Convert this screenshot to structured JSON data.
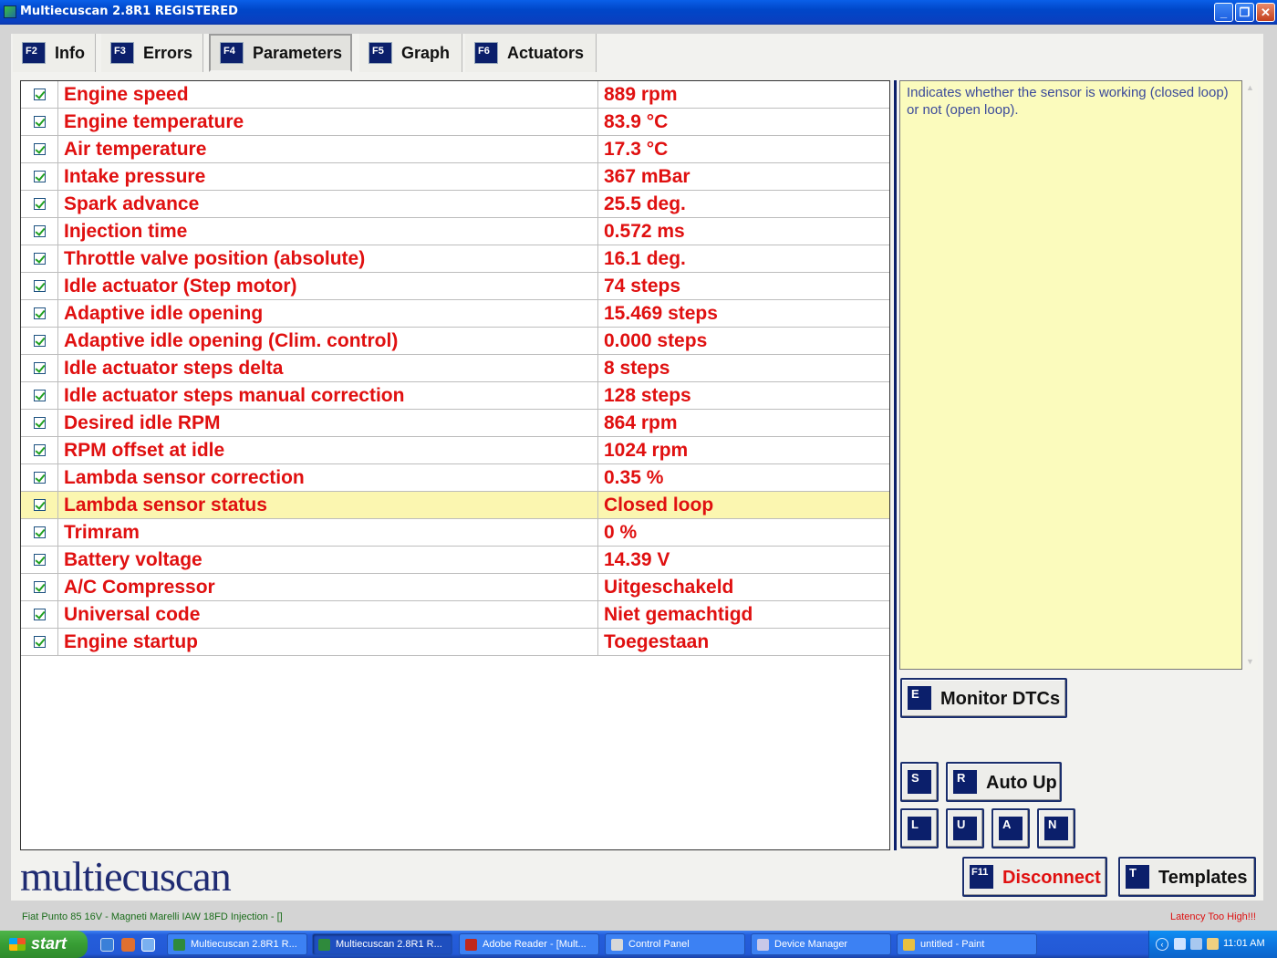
{
  "window": {
    "title": "Multiecuscan 2.8R1 REGISTERED",
    "minimize": "_",
    "maximize": "❐",
    "close": "✕"
  },
  "tabs": [
    {
      "key": "F2",
      "label": "Info"
    },
    {
      "key": "F3",
      "label": "Errors"
    },
    {
      "key": "F4",
      "label": "Parameters"
    },
    {
      "key": "F5",
      "label": "Graph"
    },
    {
      "key": "F6",
      "label": "Actuators"
    }
  ],
  "active_tab": "Parameters",
  "parameters": [
    {
      "name": "Engine speed",
      "value": "889 rpm",
      "checked": true
    },
    {
      "name": "Engine temperature",
      "value": "83.9 °C",
      "checked": true
    },
    {
      "name": "Air temperature",
      "value": "17.3 °C",
      "checked": true
    },
    {
      "name": "Intake pressure",
      "value": "367 mBar",
      "checked": true
    },
    {
      "name": "Spark advance",
      "value": "25.5 deg.",
      "checked": true
    },
    {
      "name": "Injection time",
      "value": "0.572 ms",
      "checked": true
    },
    {
      "name": "Throttle valve position (absolute)",
      "value": "16.1 deg.",
      "checked": true
    },
    {
      "name": "Idle actuator (Step motor)",
      "value": "74 steps",
      "checked": true
    },
    {
      "name": "Adaptive idle opening",
      "value": "15.469 steps",
      "checked": true
    },
    {
      "name": "Adaptive idle opening (Clim. control)",
      "value": "0.000 steps",
      "checked": true
    },
    {
      "name": "Idle actuator steps delta",
      "value": "8 steps",
      "checked": true
    },
    {
      "name": "Idle actuator steps manual correction",
      "value": "128 steps",
      "checked": true
    },
    {
      "name": "Desired idle RPM",
      "value": "864 rpm",
      "checked": true
    },
    {
      "name": "RPM offset at idle",
      "value": "1024 rpm",
      "checked": true
    },
    {
      "name": "Lambda sensor correction",
      "value": "0.35 %",
      "checked": true
    },
    {
      "name": "Lambda sensor status",
      "value": "Closed loop",
      "checked": true,
      "selected": true
    },
    {
      "name": "Trimram",
      "value": "0 %",
      "checked": true
    },
    {
      "name": "Battery voltage",
      "value": "14.39 V",
      "checked": true
    },
    {
      "name": "A/C Compressor",
      "value": "Uitgeschakeld",
      "checked": true
    },
    {
      "name": "Universal code",
      "value": "Niet gemachtigd",
      "checked": true
    },
    {
      "name": "Engine startup",
      "value": "Toegestaan",
      "checked": true
    }
  ],
  "description": "Indicates whether the sensor is working (closed loop) or not (open loop).",
  "buttons": {
    "monitor": {
      "key": "E",
      "label": "Monitor DTCs"
    },
    "s": {
      "key": "S"
    },
    "auto_up": {
      "key": "R",
      "label": "Auto Up"
    },
    "l": {
      "key": "L"
    },
    "u": {
      "key": "U"
    },
    "a": {
      "key": "A"
    },
    "n": {
      "key": "N"
    },
    "disconnect": {
      "key": "F11",
      "label": "Disconnect"
    },
    "templates": {
      "key": "T",
      "label": "Templates"
    }
  },
  "logo": "multiecuscan",
  "status": {
    "vehicle": "Fiat Punto 85 16V - Magneti Marelli IAW 18FD Injection - []",
    "latency": "Latency Too High!!!"
  },
  "taskbar": {
    "start": "start",
    "tasks": [
      {
        "label": "Multiecuscan 2.8R1 R...",
        "icon_color": "#2f8a3c",
        "active": false
      },
      {
        "label": "Multiecuscan 2.8R1 R...",
        "icon_color": "#2f8a3c",
        "active": true
      },
      {
        "label": "Adobe Reader - [Mult...",
        "icon_color": "#c0281c",
        "active": false
      },
      {
        "label": "Control Panel",
        "icon_color": "#d8d8d8",
        "active": false
      },
      {
        "label": "Device Manager",
        "icon_color": "#c8c8e8",
        "active": false
      },
      {
        "label": "untitled - Paint",
        "icon_color": "#e8c040",
        "active": false
      }
    ],
    "clock": "11:01 AM"
  },
  "colors": {
    "param_text": "#e01010",
    "key_badge": "#0b1f6b",
    "highlight_row": "#fbf6b0",
    "description_bg": "#fbfbbd",
    "status_ok": "#1b6d1b",
    "status_warn": "#d11"
  }
}
